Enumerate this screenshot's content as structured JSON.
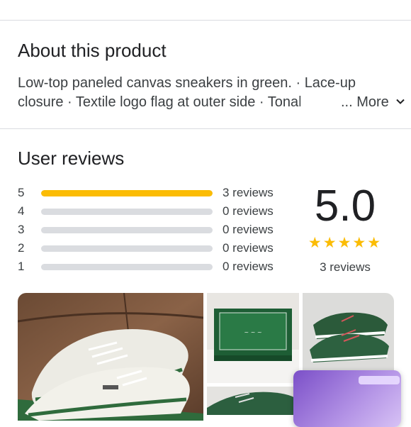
{
  "about": {
    "title": "About this product",
    "line1": "Low-top paneled canvas sneakers in green. · Lace-up",
    "line2": "closure · Textile logo flag at outer side · Tonal",
    "more_prefix": "...",
    "more_label": "More"
  },
  "reviews": {
    "title": "User reviews",
    "average": "5.0",
    "stars": "★★★★★",
    "total_label": "3 reviews",
    "breakdown": [
      {
        "stars": "5",
        "count_label": "3 reviews",
        "fraction": 1.0
      },
      {
        "stars": "4",
        "count_label": "0 reviews",
        "fraction": 0
      },
      {
        "stars": "3",
        "count_label": "0 reviews",
        "fraction": 0
      },
      {
        "stars": "2",
        "count_label": "0 reviews",
        "fraction": 0
      },
      {
        "stars": "1",
        "count_label": "0 reviews",
        "fraction": 0
      }
    ]
  },
  "colors": {
    "star": "#fbbc04",
    "bar_track": "#dadce0",
    "text": "#202124",
    "secondary_text": "#3c4043"
  }
}
